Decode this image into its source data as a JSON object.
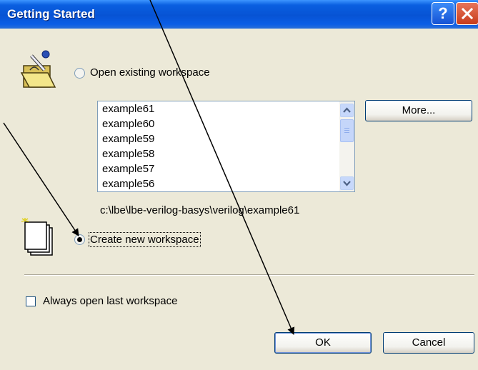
{
  "window": {
    "title": "Getting Started",
    "help_label": "?"
  },
  "open_workspace": {
    "label": "Open existing workspace",
    "items": [
      "example61",
      "example60",
      "example59",
      "example58",
      "example57",
      "example56"
    ],
    "more_label": "More...",
    "path": "c:\\lbe\\lbe-verilog-basys\\verilog\\example61",
    "selected": false
  },
  "create_workspace": {
    "label": "Create new workspace",
    "selected": true
  },
  "always_open_last": {
    "label": "Always open last workspace",
    "checked": false
  },
  "buttons": {
    "ok_label": "OK",
    "cancel_label": "Cancel"
  },
  "icons": {
    "open": "open-folder-icon",
    "new": "new-document-icon",
    "help": "help-icon",
    "close": "close-icon"
  },
  "colors": {
    "title_bar": "#0753d4",
    "dialog_bg": "#ece9d8",
    "close_button": "#c73c1c"
  }
}
